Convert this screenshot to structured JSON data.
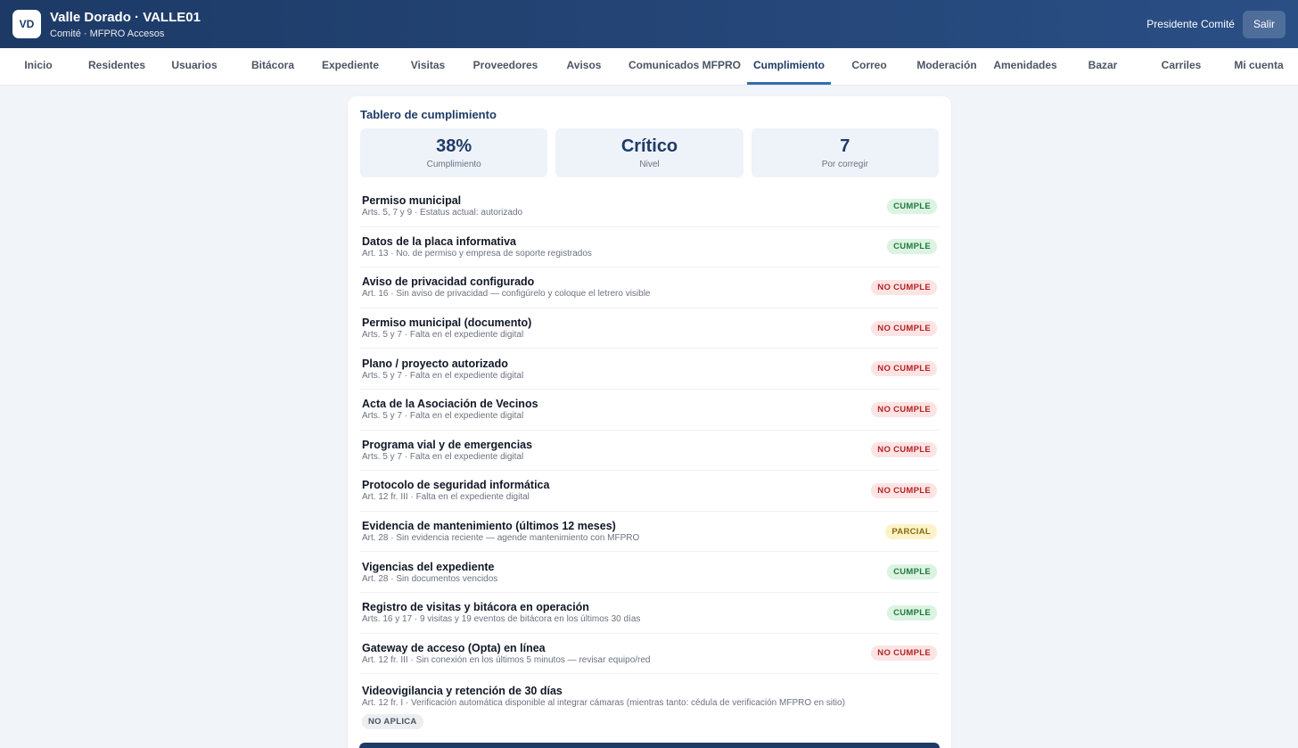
{
  "header": {
    "logo": "VD",
    "title": "Valle Dorado · VALLE01",
    "subtitle": "Comité · MFPRO Accesos",
    "user": "Presidente Comité",
    "logout": "Salir"
  },
  "nav": [
    {
      "label": "Inicio"
    },
    {
      "label": "Residentes"
    },
    {
      "label": "Usuarios"
    },
    {
      "label": "Bitácora"
    },
    {
      "label": "Expediente"
    },
    {
      "label": "Visitas"
    },
    {
      "label": "Proveedores"
    },
    {
      "label": "Avisos"
    },
    {
      "label": "Comunicados MFPRO"
    },
    {
      "label": "Cumplimiento",
      "active": true
    },
    {
      "label": "Correo"
    },
    {
      "label": "Moderación"
    },
    {
      "label": "Amenidades"
    },
    {
      "label": "Bazar"
    },
    {
      "label": "Carriles"
    },
    {
      "label": "Mi cuenta"
    }
  ],
  "dashboard": {
    "title": "Tablero de cumplimiento",
    "stats": [
      {
        "value": "38%",
        "label": "Cumplimiento"
      },
      {
        "value": "Crítico",
        "label": "Nivel"
      },
      {
        "value": "7",
        "label": "Por corregir"
      }
    ],
    "items": [
      {
        "title": "Permiso municipal",
        "sub": "Arts. 5, 7 y 9 · Estatus actual: autorizado",
        "status": "CUMPLE",
        "kind": "ok"
      },
      {
        "title": "Datos de la placa informativa",
        "sub": "Art. 13 · No. de permiso y empresa de soporte registrados",
        "status": "CUMPLE",
        "kind": "ok"
      },
      {
        "title": "Aviso de privacidad configurado",
        "sub": "Art. 16 · Sin aviso de privacidad — configúrelo y coloque el letrero visible",
        "status": "NO CUMPLE",
        "kind": "no"
      },
      {
        "title": "Permiso municipal (documento)",
        "sub": "Arts. 5 y 7 · Falta en el expediente digital",
        "status": "NO CUMPLE",
        "kind": "no"
      },
      {
        "title": "Plano / proyecto autorizado",
        "sub": "Arts. 5 y 7 · Falta en el expediente digital",
        "status": "NO CUMPLE",
        "kind": "no"
      },
      {
        "title": "Acta de la Asociación de Vecinos",
        "sub": "Arts. 5 y 7 · Falta en el expediente digital",
        "status": "NO CUMPLE",
        "kind": "no"
      },
      {
        "title": "Programa vial y de emergencias",
        "sub": "Arts. 5 y 7 · Falta en el expediente digital",
        "status": "NO CUMPLE",
        "kind": "no"
      },
      {
        "title": "Protocolo de seguridad informática",
        "sub": "Art. 12 fr. III · Falta en el expediente digital",
        "status": "NO CUMPLE",
        "kind": "no"
      },
      {
        "title": "Evidencia de mantenimiento (últimos 12 meses)",
        "sub": "Art. 28 · Sin evidencia reciente — agende mantenimiento con MFPRO",
        "status": "PARCIAL",
        "kind": "part"
      },
      {
        "title": "Vigencias del expediente",
        "sub": "Art. 28 · Sin documentos vencidos",
        "status": "CUMPLE",
        "kind": "ok"
      },
      {
        "title": "Registro de visitas y bitácora en operación",
        "sub": "Arts. 16 y 17 · 9 visitas y 19 eventos de bitácora en los últimos 30 días",
        "status": "CUMPLE",
        "kind": "ok"
      },
      {
        "title": "Gateway de acceso (Opta) en línea",
        "sub": "Art. 12 fr. III · Sin conexión en los últimos 5 minutos — revisar equipo/red",
        "status": "NO CUMPLE",
        "kind": "no"
      },
      {
        "title": "Videovigilancia y retención de 30 días",
        "sub": "Art. 12 fr. I · Verificación automática disponible al integrar cámaras (mientras tanto: cédula de verificación MFPRO en sitio)",
        "status": "NO APLICA",
        "kind": "na"
      }
    ]
  }
}
